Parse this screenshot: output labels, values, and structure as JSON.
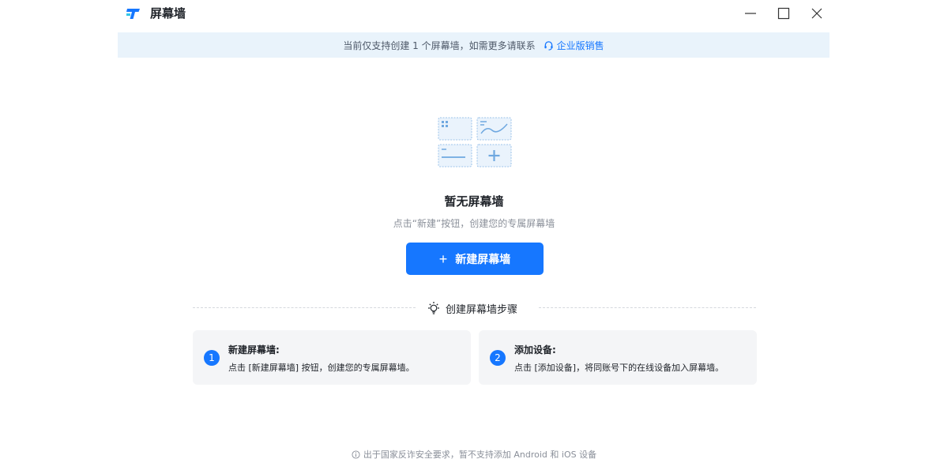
{
  "window": {
    "title": "屏幕墙"
  },
  "notice": {
    "text": "当前仅支持创建 1 个屏幕墙，如需更多请联系",
    "link_label": "企业版销售"
  },
  "empty_state": {
    "title": "暂无屏幕墙",
    "description": "点击“新建”按钮，创建您的专属屏幕墙",
    "create_button_label": "新建屏幕墙"
  },
  "steps": {
    "heading": "创建屏幕墙步骤",
    "items": [
      {
        "number": "1",
        "title": "新建屏幕墙:",
        "description": "点击 [新建屏幕墙] 按钮，创建您的专属屏幕墙。"
      },
      {
        "number": "2",
        "title": "添加设备:",
        "description": "点击 [添加设备]，将同账号下的在线设备加入屏幕墙。"
      }
    ]
  },
  "footer": {
    "note": "出于国家反诈安全要求，暂不支持添加 Android 和 iOS 设备"
  },
  "colors": {
    "accent": "#1677ff",
    "banner_bg": "#e9f3fb",
    "card_bg": "#f4f5f7",
    "muted_text": "#8a8f99"
  },
  "icons": {
    "app_logo": "app-logo-icon",
    "minimize": "minimize-icon",
    "maximize": "maximize-icon",
    "close": "close-icon",
    "headset": "headset-icon",
    "lightbulb": "lightbulb-icon",
    "info": "info-icon",
    "plus": "plus-icon"
  }
}
